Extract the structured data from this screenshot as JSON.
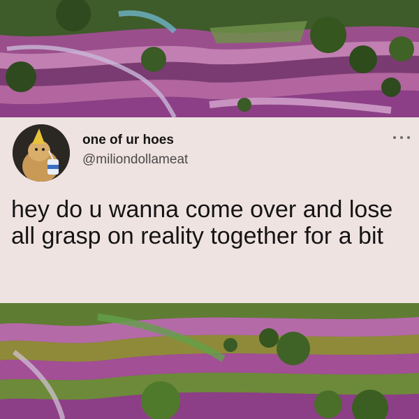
{
  "tweet": {
    "display_name": "one of ur hoes",
    "handle": "@miliondollameat",
    "text": "hey do u wanna come over and lose all grasp on reality together for a bit"
  },
  "icons": {
    "more": "more-options-icon"
  },
  "colors": {
    "card_background": "#efe3e1",
    "text": "#141414",
    "handle": "#4a4a4a",
    "terrace_purple": "#8c3f86",
    "terrace_green": "#4f7a2c"
  }
}
